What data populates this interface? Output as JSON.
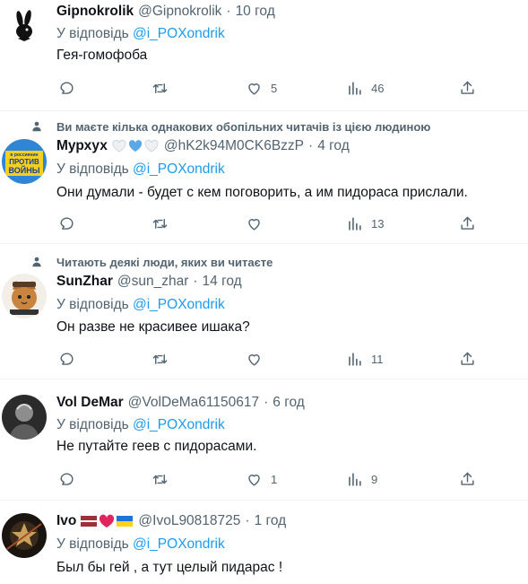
{
  "tweets": [
    {
      "name": "Gipnokrolik",
      "handle": "@Gipnokrolik",
      "time": "10 год",
      "reply_prefix": "У відповідь",
      "mention": "@i_POXondrik",
      "text": "Гея-гомофоба",
      "likes": "5",
      "views": "46",
      "avatar": "playboy-bunny-logo"
    },
    {
      "social_context": "Ви маєте кілька однакових обопільних читачів із цією людиною",
      "name": "Мурхух",
      "handle": "@hK2k94M0CK6BzzP",
      "time": "4 год",
      "reply_prefix": "У відповідь",
      "mention": "@i_POXondrik",
      "text": "Они думали - будет с кем поговорить, а им пидораса прислали.",
      "likes": "",
      "views": "13",
      "avatar": "russians-against-war-sign",
      "avatar_text": [
        "в россиянин",
        "ПРОТИВ",
        "ВОЙНЫ"
      ]
    },
    {
      "social_context": "Читають деякі люди, яких ви читаєте",
      "name": "SunZhar",
      "handle": "@sun_zhar",
      "time": "14 год",
      "reply_prefix": "У відповідь",
      "mention": "@i_POXondrik",
      "text": "Он разве не красивее ишака?",
      "likes": "",
      "views": "11",
      "avatar": "cat-with-hat"
    },
    {
      "name": "Vol DeMar",
      "handle": "@VolDeMa61150617",
      "time": "6 год",
      "reply_prefix": "У відповідь",
      "mention": "@i_POXondrik",
      "text": "Не путайте геев с пидорасами.",
      "likes": "1",
      "views": "9",
      "avatar": "dark-portrait-photo"
    },
    {
      "name": "Ivo",
      "handle": "@IvoL90818725",
      "time": "1 год",
      "reply_prefix": "У відповідь",
      "mention": "@i_POXondrik",
      "text": "Был бы гей , а тут целый пидарас !",
      "avatar": "star-emblem-avatar"
    }
  ],
  "colors": {
    "text_primary": "#0f1419",
    "text_secondary": "#536471",
    "link": "#1d9bf0",
    "divider": "#eff3f4"
  }
}
